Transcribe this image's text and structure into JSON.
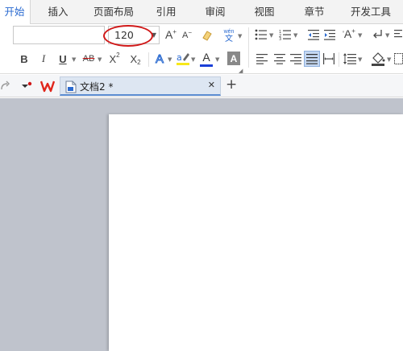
{
  "menu": {
    "tabs": [
      {
        "label": "开始",
        "active": true
      },
      {
        "label": "插入"
      },
      {
        "label": "页面布局"
      },
      {
        "label": "引用"
      },
      {
        "label": "审阅"
      },
      {
        "label": "视图"
      },
      {
        "label": "章节"
      },
      {
        "label": "开发工具"
      }
    ]
  },
  "ribbon": {
    "font_name": {
      "value": ""
    },
    "font_size": {
      "value": "120"
    },
    "grow_font_label": "A",
    "shrink_font_label": "A",
    "pinyin": {
      "top": "wén",
      "bottom": "文"
    },
    "bold_label": "B",
    "italic_label": "I",
    "underline_label": "U",
    "strikethrough_label": "AB",
    "superscript_label": "X",
    "superscript_mark": "2",
    "subscript_label": "X",
    "subscript_mark": "2",
    "text_effect_label": "A",
    "font_color_label": "A",
    "char_shading_label": "A",
    "change_case_label": "A",
    "colors": {
      "font_color": "#1a3fd8",
      "highlight": "#f7e81a",
      "highlight_accent": "#2a6ad0",
      "annotation_ring": "#d01818"
    }
  },
  "tabbar": {
    "doc_title": "文档2 *",
    "close_glyph": "✕",
    "new_tab_glyph": "+"
  },
  "icons": [
    "redo-icon",
    "quick-access-menu-icon",
    "wps-logo-icon",
    "document-icon",
    "format-painter-icon",
    "clear-format-icon",
    "bullet-list-icon",
    "numbered-list-icon",
    "decrease-indent-icon",
    "increase-indent-icon",
    "sort-icon",
    "align-left-icon",
    "align-center-icon",
    "align-right-icon",
    "justify-icon",
    "distributed-align-icon",
    "line-spacing-icon",
    "paint-bucket-icon",
    "border-icon",
    "return-arrow-icon",
    "paragraph-mark-icon",
    "dialog-launcher-icon"
  ]
}
